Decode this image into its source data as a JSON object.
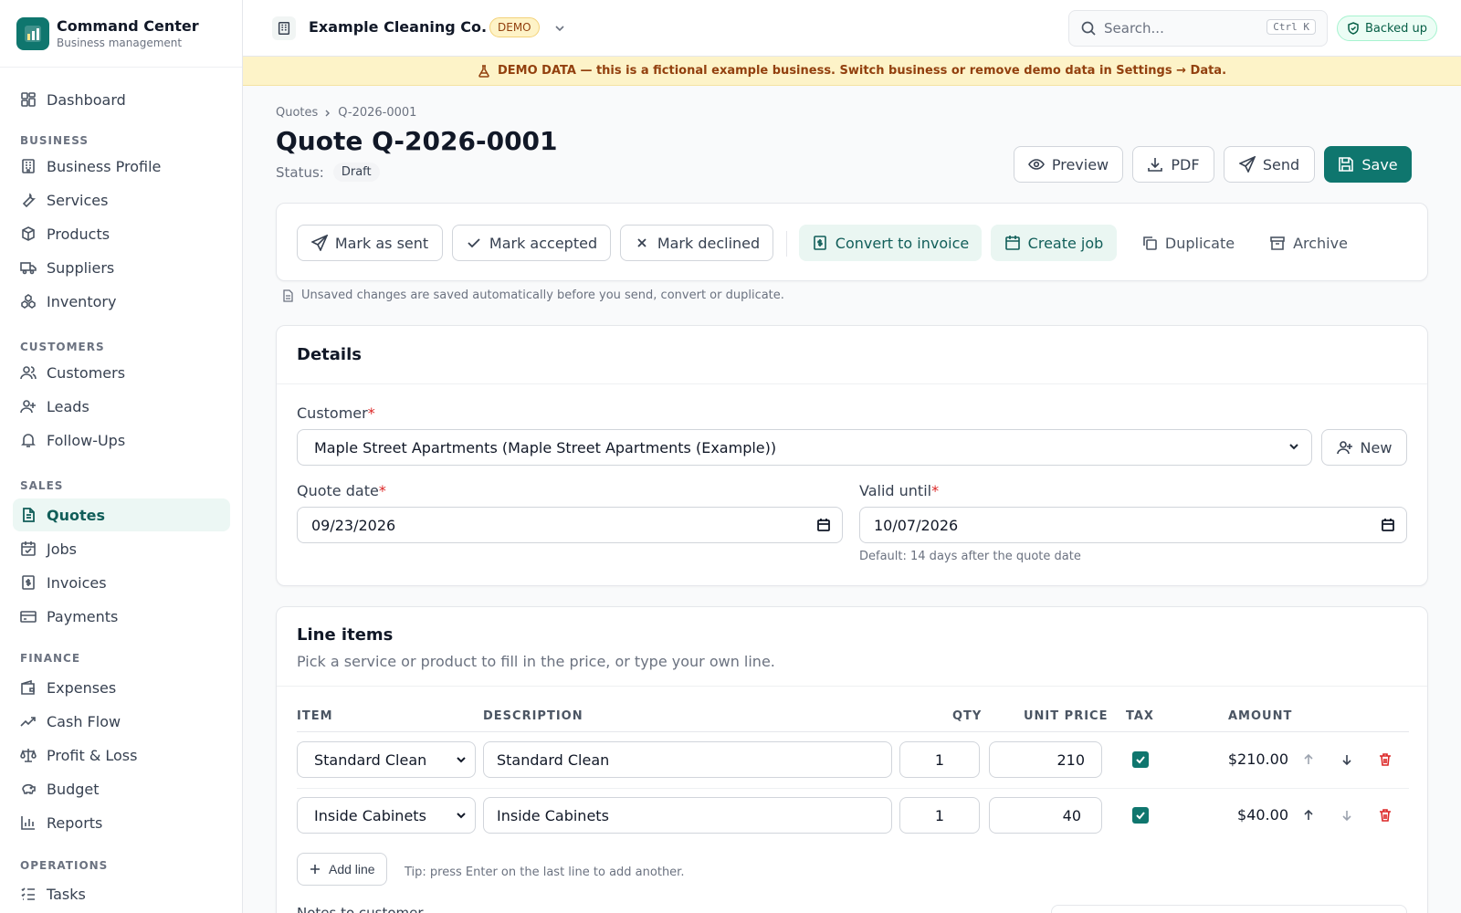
{
  "brand": {
    "title": "Command Center",
    "subtitle": "Business management"
  },
  "sidebar": {
    "dashboard": "Dashboard",
    "sections": [
      {
        "title": "BUSINESS",
        "items": [
          "Business Profile",
          "Services",
          "Products",
          "Suppliers",
          "Inventory"
        ]
      },
      {
        "title": "CUSTOMERS",
        "items": [
          "Customers",
          "Leads",
          "Follow-Ups"
        ]
      },
      {
        "title": "SALES",
        "items": [
          "Quotes",
          "Jobs",
          "Invoices",
          "Payments"
        ]
      },
      {
        "title": "FINANCE",
        "items": [
          "Expenses",
          "Cash Flow",
          "Profit & Loss",
          "Budget",
          "Reports"
        ]
      },
      {
        "title": "OPERATIONS",
        "items": [
          "Tasks"
        ]
      }
    ],
    "active": "Quotes"
  },
  "topbar": {
    "business_name": "Example Cleaning Co.",
    "demo_badge": "DEMO",
    "search_placeholder": "Search...",
    "search_shortcut": "Ctrl K",
    "backup_status": "Backed up"
  },
  "banner": {
    "text": "DEMO DATA — this is a fictional example business. Switch business or remove demo data in Settings → Data."
  },
  "breadcrumb": {
    "parent": "Quotes",
    "current": "Q-2026-0001"
  },
  "page": {
    "title": "Quote Q-2026-0001",
    "status_label": "Status:",
    "status_value": "Draft"
  },
  "header_actions": {
    "preview": "Preview",
    "pdf": "PDF",
    "send": "Send",
    "save": "Save"
  },
  "actions": {
    "mark_sent": "Mark as sent",
    "mark_accepted": "Mark accepted",
    "mark_declined": "Mark declined",
    "convert_invoice": "Convert to invoice",
    "create_job": "Create job",
    "duplicate": "Duplicate",
    "archive": "Archive",
    "autosave_note": "Unsaved changes are saved automatically before you send, convert or duplicate."
  },
  "details": {
    "title": "Details",
    "customer_label": "Customer",
    "customer_value": "Maple Street Apartments (Maple Street Apartments (Example))",
    "new_button": "New",
    "quote_date_label": "Quote date",
    "quote_date_value": "09/23/2026",
    "valid_until_label": "Valid until",
    "valid_until_value": "10/07/2026",
    "valid_hint": "Default: 14 days after the quote date"
  },
  "line_items": {
    "title": "Line items",
    "subtitle": "Pick a service or product to fill in the price, or type your own line.",
    "columns": {
      "item": "ITEM",
      "description": "DESCRIPTION",
      "qty": "QTY",
      "unit_price": "UNIT PRICE",
      "tax": "TAX",
      "amount": "AMOUNT"
    },
    "rows": [
      {
        "item": "Standard Clean",
        "description": "Standard Clean",
        "qty": "1",
        "unit_price": "210",
        "tax": true,
        "amount": "$210.00"
      },
      {
        "item": "Inside Cabinets",
        "description": "Inside Cabinets",
        "qty": "1",
        "unit_price": "40",
        "tax": true,
        "amount": "$40.00"
      }
    ],
    "add_line": "Add line",
    "tip": "Tip: press Enter on the last line to add another.",
    "notes_label": "Notes to customer"
  },
  "colors": {
    "accent": "#0f766e",
    "danger": "#dc2626",
    "banner": "#fdf3c8"
  },
  "icons": [
    "dashboard-icon",
    "building-icon",
    "wrench-icon",
    "box-icon",
    "truck-icon",
    "boxes-icon",
    "users-icon",
    "user-plus-icon",
    "bell-icon",
    "file-text-icon",
    "calendar-check-icon",
    "receipt-icon",
    "credit-card-icon",
    "wallet-icon",
    "trend-up-icon",
    "scale-icon",
    "piggy-bank-icon",
    "bar-chart-icon",
    "list-icon",
    "search-icon",
    "shield-check-icon",
    "flask-icon",
    "eye-icon",
    "download-icon",
    "send-icon",
    "save-icon",
    "check-icon",
    "x-icon",
    "copy-icon",
    "archive-icon",
    "calendar-icon",
    "trash-icon",
    "arrow-up-icon",
    "arrow-down-icon",
    "plus-icon"
  ]
}
